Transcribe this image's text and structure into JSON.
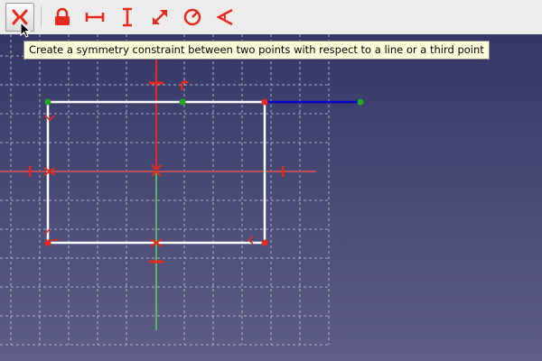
{
  "toolbar": {
    "tools": [
      {
        "name": "symmetry-constraint",
        "icon": "symmetry-icon",
        "active": true
      },
      {
        "name": "lock-constraint",
        "icon": "lock-icon"
      },
      {
        "name": "horizontal-distance-constraint",
        "icon": "horizontal-distance-icon"
      },
      {
        "name": "vertical-distance-constraint",
        "icon": "vertical-distance-icon"
      },
      {
        "name": "length-constraint",
        "icon": "diagonal-arrow-icon"
      },
      {
        "name": "radius-constraint",
        "icon": "radius-icon"
      },
      {
        "name": "angle-constraint",
        "icon": "angle-icon"
      }
    ]
  },
  "tooltip": {
    "text": "Create a symmetry constraint between two points with respect to a line or a third point"
  },
  "colors": {
    "constraint": "#e8281c",
    "geometry": "#ffffff",
    "selected_line": "#0000c8",
    "green_point": "#22aa22",
    "axis_vertical": "#55dd55",
    "axis_horizontal": "#e05050",
    "grid": "#c8c8dc",
    "background_top": "#343766",
    "background_bottom": "#5e5e86"
  }
}
